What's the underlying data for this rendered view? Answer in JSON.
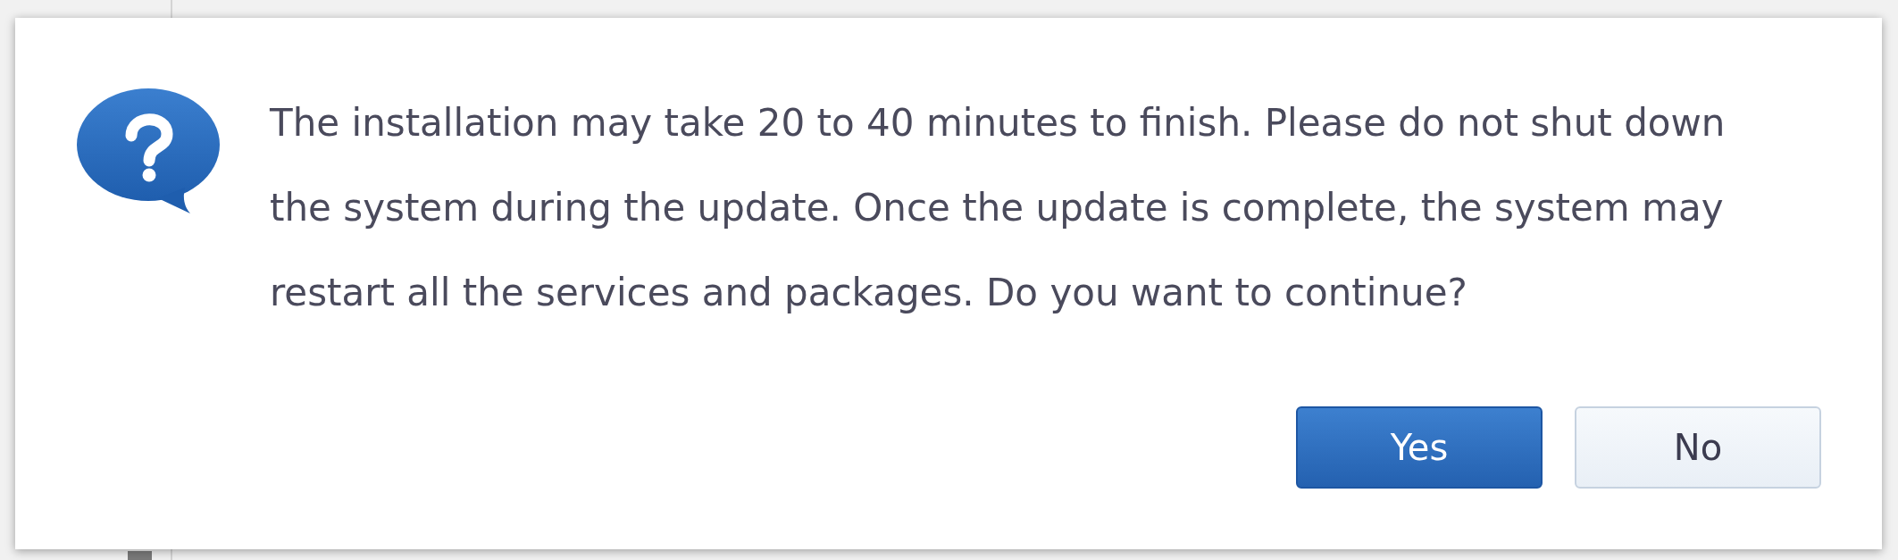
{
  "dialog": {
    "message": "The installation may take 20 to 40 minutes to finish. Please do not shut down the system during the update. Once the update is complete, the system may restart all the services and packages. Do you want to continue?",
    "buttons": [
      {
        "label": "Yes",
        "kind": "primary"
      },
      {
        "label": "No",
        "kind": "secondary"
      }
    ]
  }
}
